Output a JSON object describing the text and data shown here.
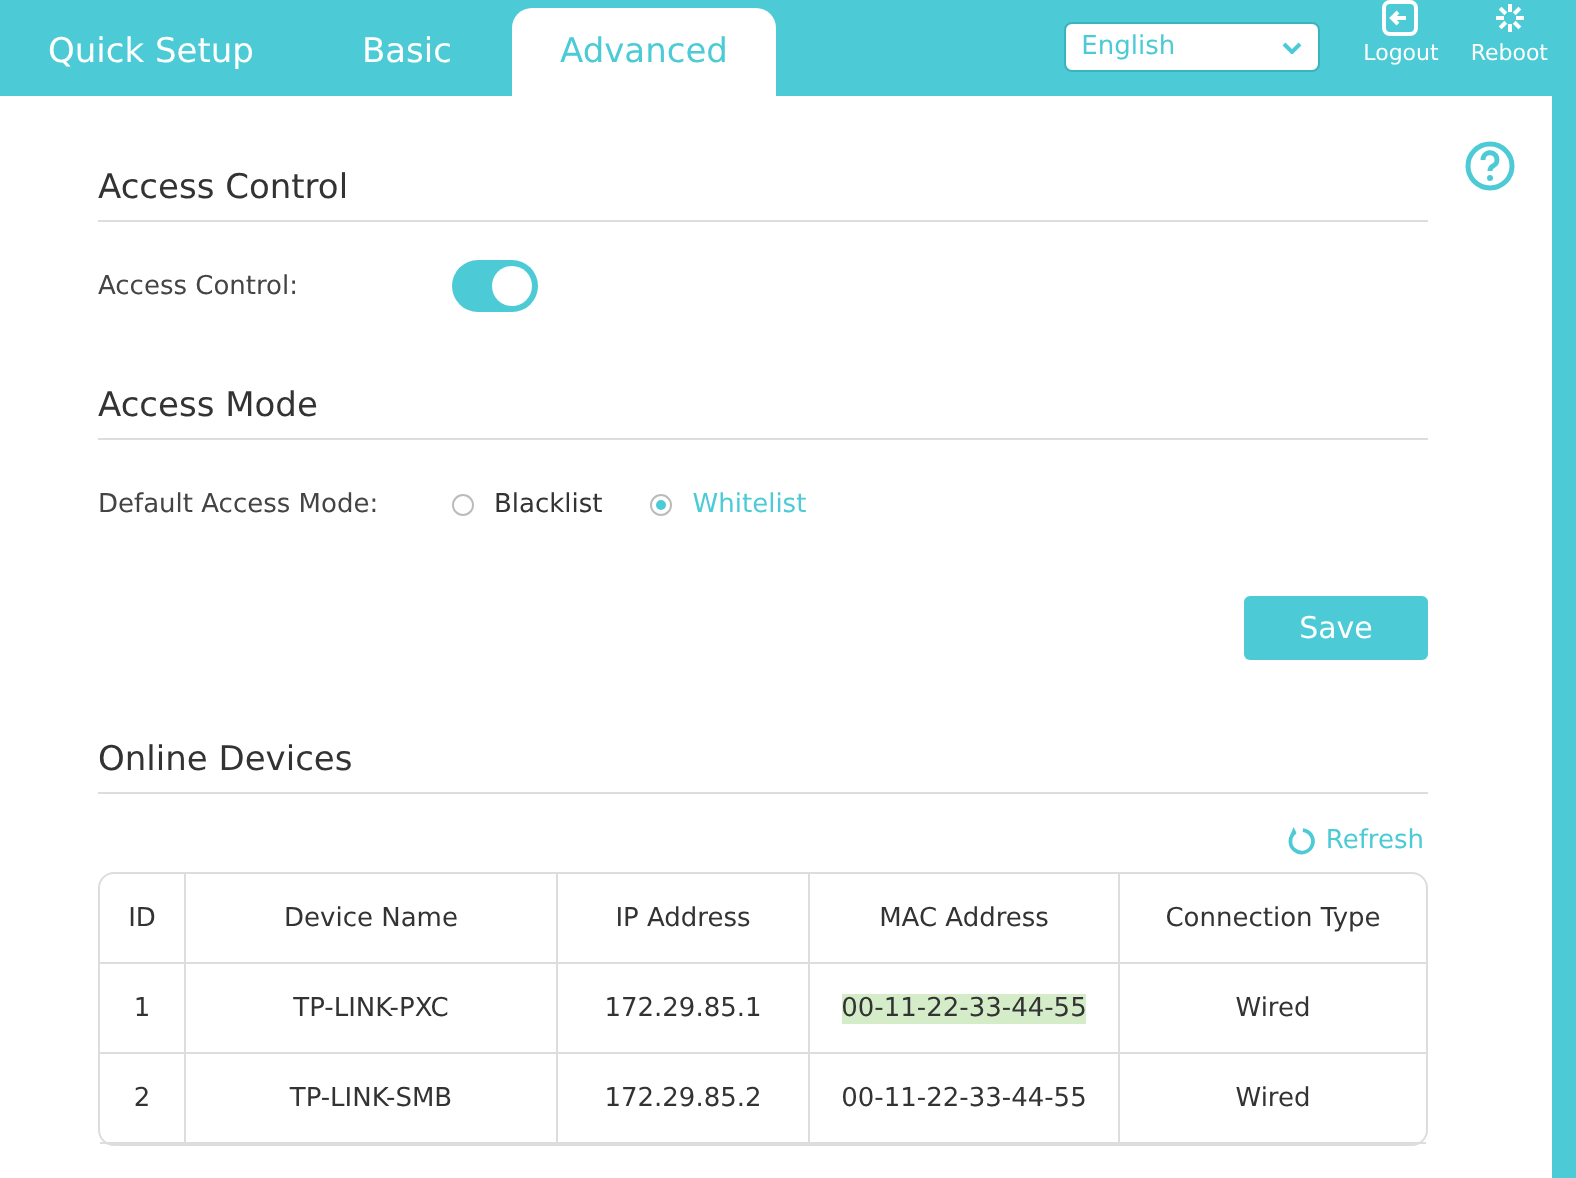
{
  "tabs": [
    {
      "label": "Quick Setup",
      "selected": false
    },
    {
      "label": "Basic",
      "selected": false
    },
    {
      "label": "Advanced",
      "selected": true
    }
  ],
  "language": {
    "value": "English"
  },
  "header_actions": [
    {
      "kind": "logout",
      "label": "Logout"
    },
    {
      "kind": "reboot",
      "label": "Reboot"
    }
  ],
  "access_control": {
    "title": "Access Control",
    "label": "Access Control:",
    "on": true
  },
  "access_mode": {
    "title": "Access Mode",
    "label": "Default Access Mode:",
    "options": [
      {
        "label": "Blacklist",
        "selected": false
      },
      {
        "label": "Whitelist",
        "selected": true
      }
    ]
  },
  "save_button": "Save",
  "online_devices": {
    "title": "Online Devices",
    "refresh": "Refresh",
    "columns": [
      "ID",
      "Device Name",
      "IP Address",
      "MAC Address",
      "Connection Type"
    ],
    "rows": [
      {
        "cells": [
          "1",
          "TP-LINK-PXC",
          "172.29.85.1",
          "00-11-22-33-44-55",
          "Wired"
        ],
        "mac_highlighted": true
      },
      {
        "cells": [
          "2",
          "TP-LINK-SMB",
          "172.29.85.2",
          "00-11-22-33-44-55",
          "Wired"
        ],
        "mac_highlighted": false
      }
    ]
  }
}
